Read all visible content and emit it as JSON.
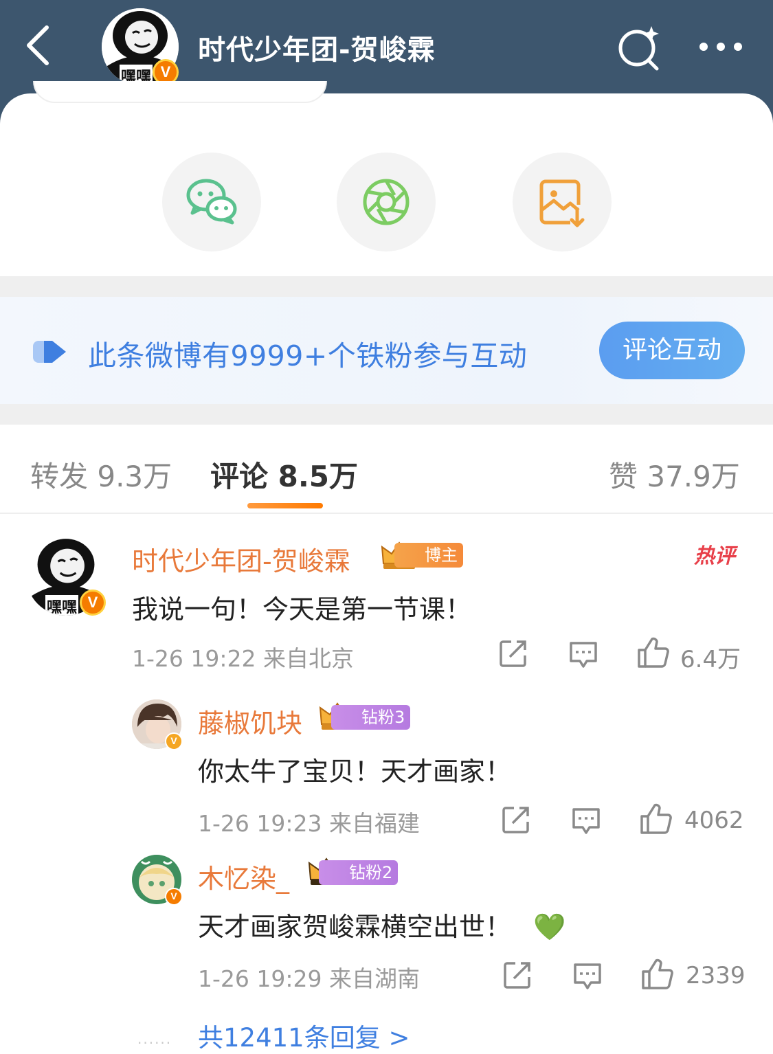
{
  "header": {
    "title": "时代少年团-贺峻霖",
    "avatar_text": "嘿嘿",
    "verified_mark": "V"
  },
  "share": {
    "icons": [
      "wechat-icon",
      "moments-icon",
      "save-image-icon"
    ]
  },
  "banner": {
    "text": "此条微博有9999+个铁粉参与互动",
    "button_label": "评论互动"
  },
  "tabs": {
    "repost": "转发 9.3万",
    "comment": "评论 8.5万",
    "like": "赞 37.9万"
  },
  "main_comment": {
    "user": "时代少年团-贺峻霖",
    "badge": "博主",
    "hot_tag": "热评",
    "text": "我说一句！今天是第一节课！",
    "meta": "1-26 19:22  来自北京",
    "likes": "6.4万",
    "avatar_text": "嘿嘿"
  },
  "replies": [
    {
      "user": "藤椒饥块",
      "badge": "钻粉3",
      "text": "你太牛了宝贝！天才画家！",
      "meta": "1-26 19:23  来自福建",
      "likes": "4062"
    },
    {
      "user": "木忆染_",
      "badge": "钻粉2",
      "text": "天才画家贺峻霖横空出世！",
      "emoji": "💚",
      "meta": "1-26 19:29  来自湖南",
      "likes": "2339"
    }
  ],
  "reply_summary": {
    "text": "共12411条回复 >",
    "leader": "......"
  },
  "colors": {
    "topbar": "#3d566e",
    "accent_orange": "#e8793a",
    "link_blue": "#3f7fe0",
    "wechat_green": "#5ac18e",
    "moments_green": "#7ccc62",
    "save_orange": "#f0a03a"
  }
}
